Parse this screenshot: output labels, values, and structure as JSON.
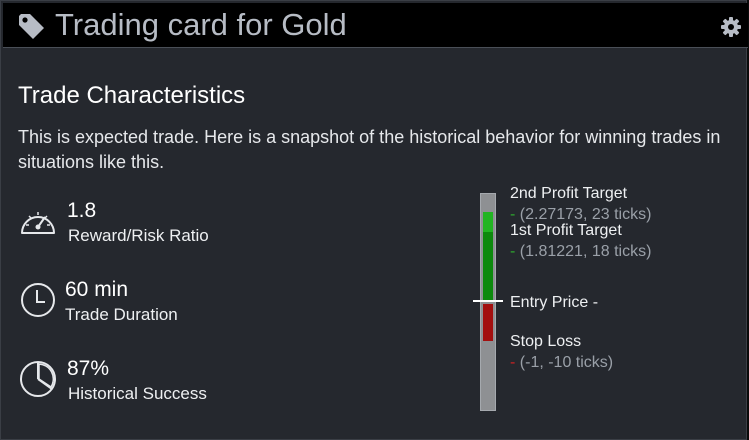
{
  "header": {
    "title": "Trading card for Gold"
  },
  "section": {
    "title": "Trade Characteristics",
    "description": "This is expected trade. Here is a snapshot of the historical behavior for winning trades in situations like this."
  },
  "metrics": [
    {
      "icon": "speedometer-icon",
      "value": "1.8",
      "label": "Reward/Risk Ratio"
    },
    {
      "icon": "clock-icon",
      "value": "60 min",
      "label": "Trade Duration"
    },
    {
      "icon": "pie-chart-icon",
      "value": "87%",
      "label": "Historical Success"
    }
  ],
  "levels": {
    "second_target": {
      "label": "2nd Profit Target",
      "dash": "-",
      "detail": "(2.27173, 23 ticks)"
    },
    "first_target": {
      "label": "1st Profit Target",
      "dash": "-",
      "detail": "(1.81221, 18 ticks)"
    },
    "entry": {
      "label": "Entry Price -"
    },
    "stop_loss": {
      "label": "Stop Loss",
      "dash": "-",
      "detail": "(-1, -10 ticks)"
    }
  },
  "colors": {
    "profit_light": "#22b522",
    "profit": "#0d8a0d",
    "loss": "#a30f0f",
    "neutral": "#8e9093"
  }
}
